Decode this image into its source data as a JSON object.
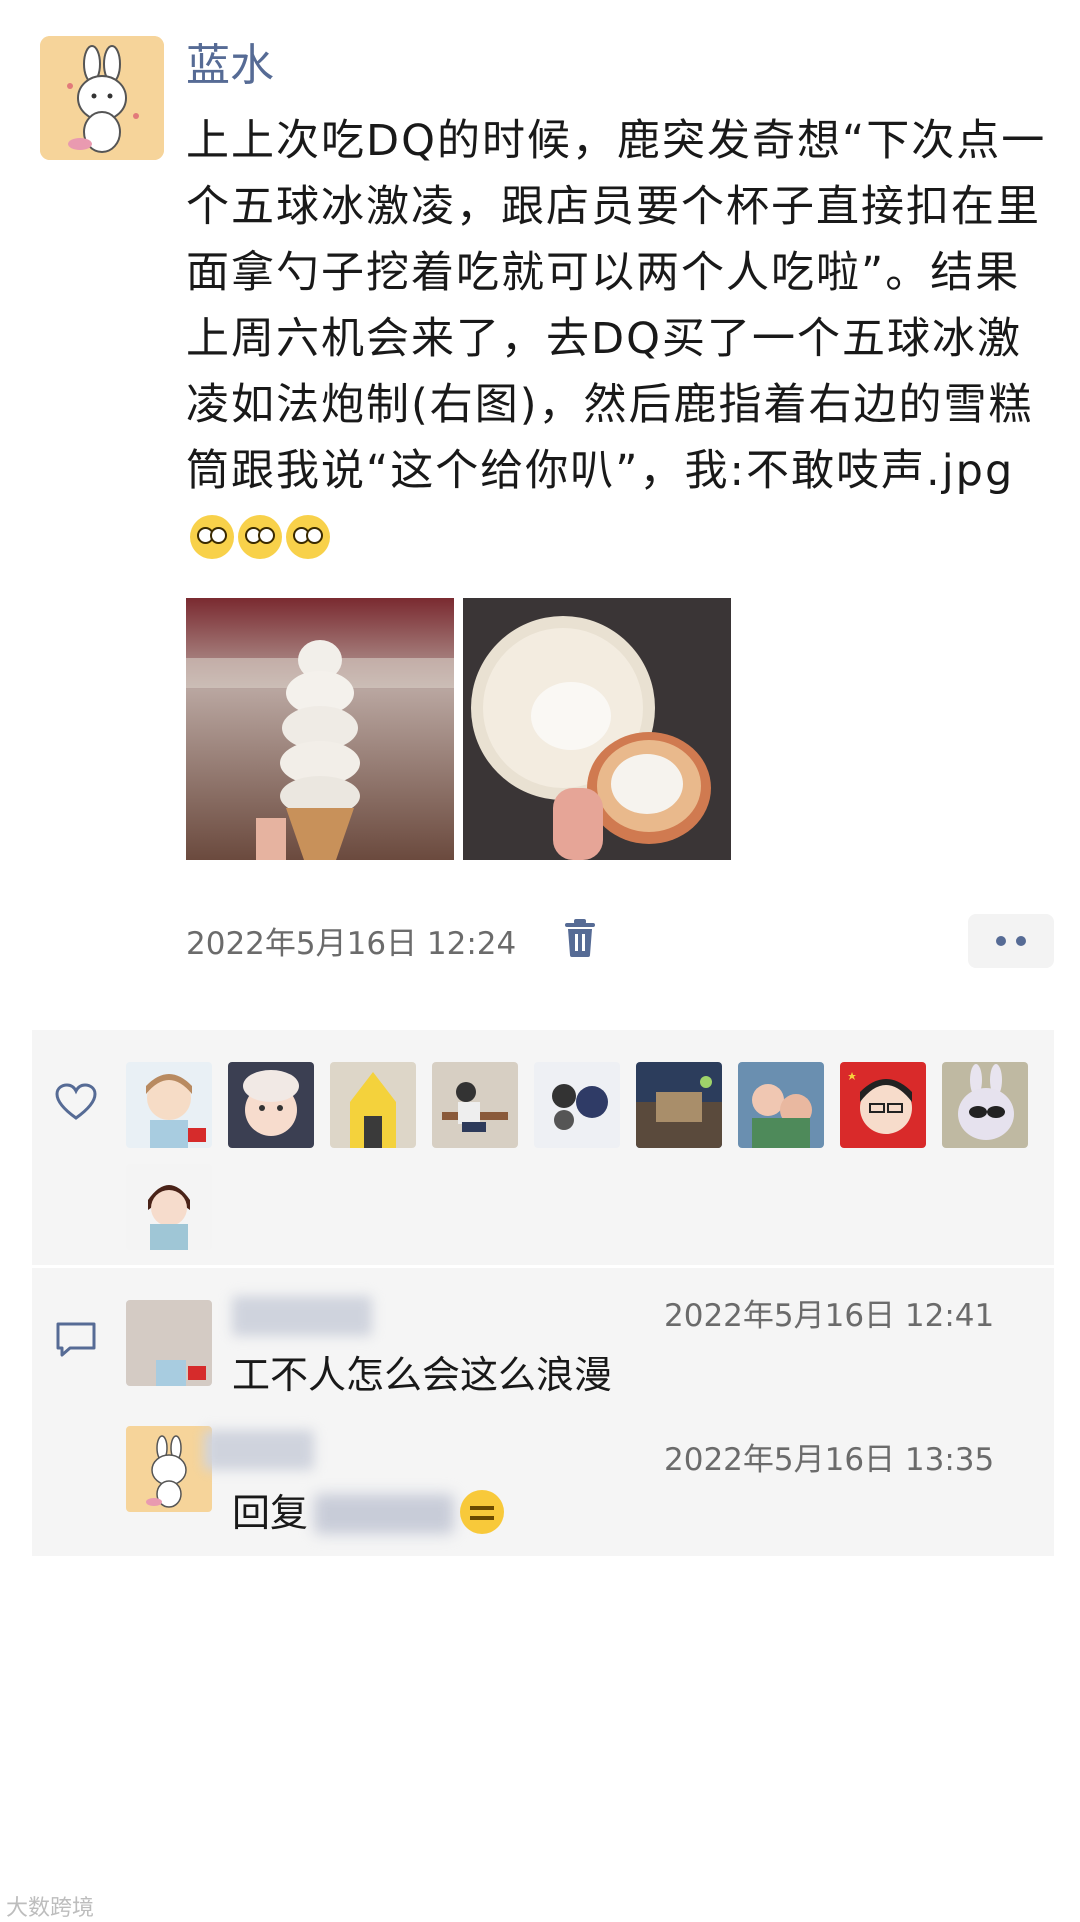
{
  "post": {
    "author": "蓝水",
    "text": "上上次吃DQ的时候，鹿突发奇想“下次点一个五球冰激凌，跟店员要个杯子直接扣在里面拿勺子挖着吃就可以两个人吃啦”。结果上周六机会来了，去DQ买了一个五球冰激凌如法炮制(右图)，然后鹿指着右边的雪糕筒跟我说“这个给你叭”，我:不敢吱声.jpg",
    "timestamp": "2022年5月16日 12:24",
    "photos": [
      "ice-cream-cone-photo",
      "ice-cream-cup-photo"
    ]
  },
  "icons": {
    "delete": "trash-icon",
    "more": "more-dots-icon",
    "like": "heart-icon",
    "comment": "comment-bubble-icon",
    "emoji": "eye-roll-emoji"
  },
  "likes": {
    "avatar_count": 10
  },
  "comments": [
    {
      "time": "2022年5月16日 12:41",
      "text": "工不人怎么会这么浪漫"
    },
    {
      "time": "2022年5月16日 13:35",
      "prefix": "回复"
    }
  ],
  "watermark": "大数跨境",
  "colors": {
    "accent": "#566b95",
    "panel": "#f5f5f5"
  }
}
